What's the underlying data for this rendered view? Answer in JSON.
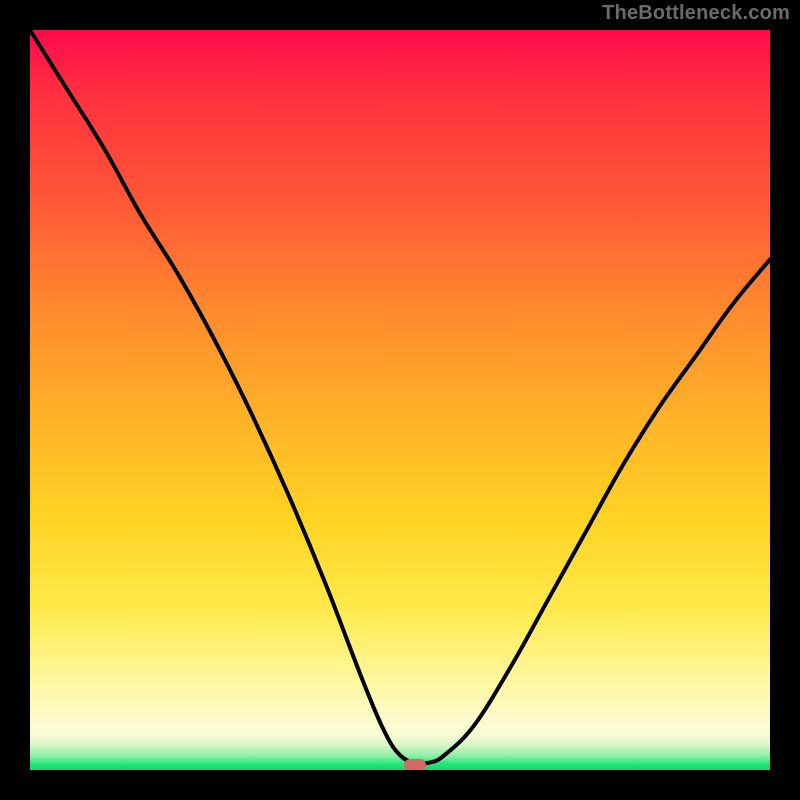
{
  "watermark": "TheBottleneck.com",
  "chart_data": {
    "type": "line",
    "title": "",
    "xlabel": "",
    "ylabel": "",
    "xlim": [
      0,
      100
    ],
    "ylim": [
      0,
      100
    ],
    "grid": false,
    "legend": false,
    "series": [
      {
        "name": "bottleneck-curve",
        "x": [
          0,
          5,
          10,
          15,
          20,
          25,
          30,
          35,
          40,
          45,
          48,
          50,
          52,
          54,
          56,
          60,
          65,
          70,
          75,
          80,
          85,
          90,
          95,
          100
        ],
        "y": [
          100,
          92,
          84,
          75,
          67,
          58,
          48,
          37,
          25,
          12,
          5,
          2,
          1,
          1,
          2,
          6,
          14,
          23,
          32,
          41,
          49,
          56,
          63,
          69
        ]
      }
    ],
    "marker": {
      "x": 52,
      "y": 0.7
    },
    "background_gradient": {
      "top": "#ff0a4a",
      "mid": "#ffd324",
      "bottom_green": "#0fd964"
    }
  }
}
